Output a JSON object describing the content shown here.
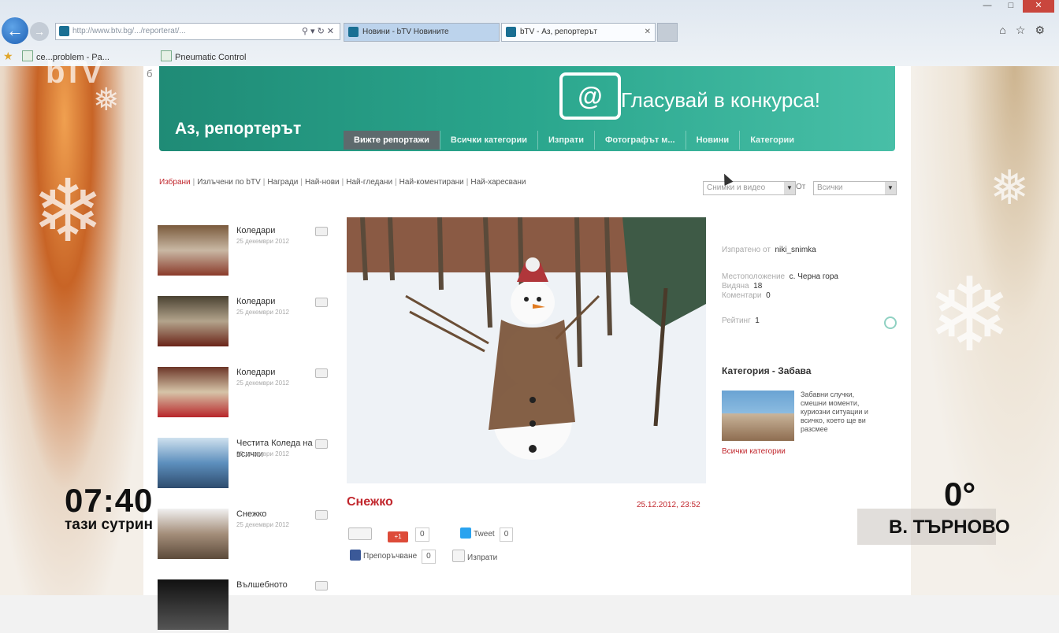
{
  "browser": {
    "address_url": "http://www.btv.bg/.../reporterat/...",
    "tabs": [
      {
        "label": "Новини - bTV Новините"
      },
      {
        "label": "bTV - Аз, репортерът"
      }
    ],
    "favorites": [
      {
        "label": "ce...problem - Pa..."
      },
      {
        "label": "Pneumatic Control"
      }
    ]
  },
  "tv": {
    "logo": "bTV",
    "time": "07:40",
    "show": "тази сутрин",
    "temperature": "0°",
    "city": "В. ТЪРНОВО"
  },
  "site": {
    "banner_title": "Аз, репортерът",
    "banner_cta": "Гласувай в конкурса!",
    "nav_tabs": [
      {
        "label": "Вижте репортажи",
        "active": true
      },
      {
        "label": "Всички категории",
        "active": false
      },
      {
        "label": "Изпрати",
        "active": false
      },
      {
        "label": "Фотографът м...",
        "active": false
      },
      {
        "label": "Новини",
        "active": false
      },
      {
        "label": "Категории",
        "active": false
      }
    ],
    "filters": [
      {
        "label": "Избрани",
        "active": true
      },
      {
        "label": "Излъчени по bTV",
        "active": false
      },
      {
        "label": "Награди",
        "active": false
      },
      {
        "label": "Най-нови",
        "active": false
      },
      {
        "label": "Най-гледани",
        "active": false
      },
      {
        "label": "Най-коментирани",
        "active": false
      },
      {
        "label": "Най-харесвани",
        "active": false
      }
    ],
    "sort_select": "Снимки и видео",
    "sort_label": "От",
    "sort_period": "Всички",
    "side_list": [
      {
        "title": "Коледари",
        "date": "25 декември 2012",
        "palette": [
          "#7a5a3c",
          "#c9b8a4",
          "#8a3a2a"
        ]
      },
      {
        "title": "Коледари",
        "date": "25 декември 2012",
        "palette": [
          "#4a4232",
          "#b3a48c",
          "#6a2418"
        ]
      },
      {
        "title": "Коледари",
        "date": "25 декември 2012",
        "palette": [
          "#6c3628",
          "#d6c4a8",
          "#b8262a"
        ]
      },
      {
        "title": "Честита Коледа на всички",
        "date": "25 декември 2012",
        "palette": [
          "#cfe1ef",
          "#5d8fbd",
          "#2e4c6e"
        ]
      },
      {
        "title": "Снежко",
        "date": "25 декември 2012",
        "palette": [
          "#f1f1f1",
          "#a48e7a",
          "#5c4a3a"
        ]
      },
      {
        "title": "Вълшебното",
        "date": "",
        "palette": [
          "#111",
          "#333",
          "#555"
        ]
      }
    ],
    "photo": {
      "caption": "Снежко",
      "date": "25.12.2012, 23:52",
      "share": {
        "gplus_count": "0",
        "tweet_label": "Tweet",
        "tweet_count": "0",
        "fb_label": "Препоръчване",
        "fb_count": "0",
        "send_label": "Изпрати"
      }
    },
    "info": {
      "author_label": "Изпратено от",
      "author": "niki_snimka",
      "location_label": "Местоположение",
      "location": "с. Черна гора",
      "views_label": "Видяна",
      "views": "18",
      "comments_label": "Коментари",
      "comments": "0",
      "rating_label": "Рейтинг",
      "rating": "1"
    },
    "category": {
      "title": "Категория - Забава",
      "description": "Забавни случки, смешни моменти, куриозни ситуации и всичко, което ще ви разсмее",
      "link": "Всички категории"
    }
  }
}
